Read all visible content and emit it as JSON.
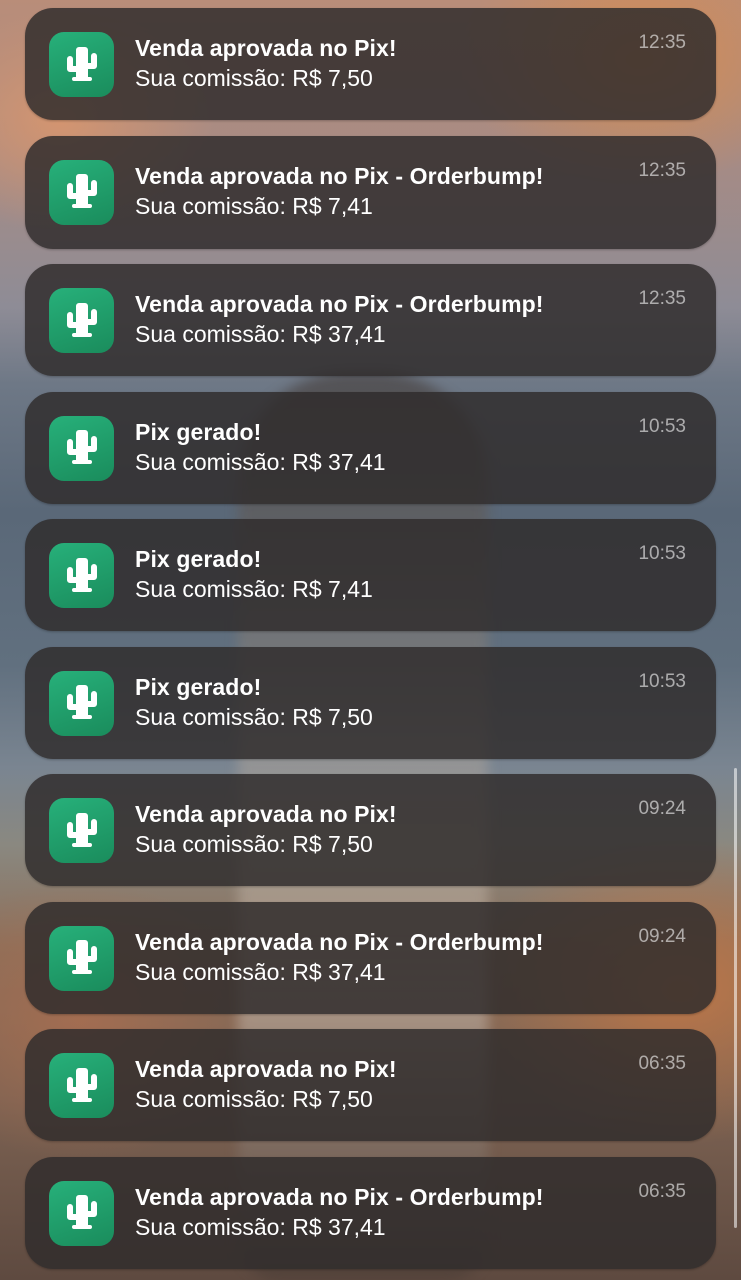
{
  "app_icon": "cactus-icon",
  "colors": {
    "icon_background": "#1f9e6b",
    "card_background": "#302c2c",
    "title_text": "#ffffff",
    "time_text": "#a9a6a6"
  },
  "notifications": [
    {
      "title": "Venda aprovada no Pix!",
      "body": "Sua comissão: R$ 7,50",
      "time": "12:35"
    },
    {
      "title": "Venda aprovada no Pix - Orderbump!",
      "body": "Sua comissão: R$ 7,41",
      "time": "12:35"
    },
    {
      "title": "Venda aprovada no Pix - Orderbump!",
      "body": "Sua comissão: R$ 37,41",
      "time": "12:35"
    },
    {
      "title": "Pix gerado!",
      "body": "Sua comissão: R$ 37,41",
      "time": "10:53"
    },
    {
      "title": "Pix gerado!",
      "body": "Sua comissão: R$ 7,41",
      "time": "10:53"
    },
    {
      "title": "Pix gerado!",
      "body": "Sua comissão: R$ 7,50",
      "time": "10:53"
    },
    {
      "title": "Venda aprovada no Pix!",
      "body": "Sua comissão: R$ 7,50",
      "time": "09:24"
    },
    {
      "title": "Venda aprovada no Pix - Orderbump!",
      "body": "Sua comissão: R$ 37,41",
      "time": "09:24"
    },
    {
      "title": "Venda aprovada no Pix!",
      "body": "Sua comissão: R$ 7,50",
      "time": "06:35"
    },
    {
      "title": "Venda aprovada no Pix - Orderbump!",
      "body": "Sua comissão: R$ 37,41",
      "time": "06:35"
    }
  ]
}
